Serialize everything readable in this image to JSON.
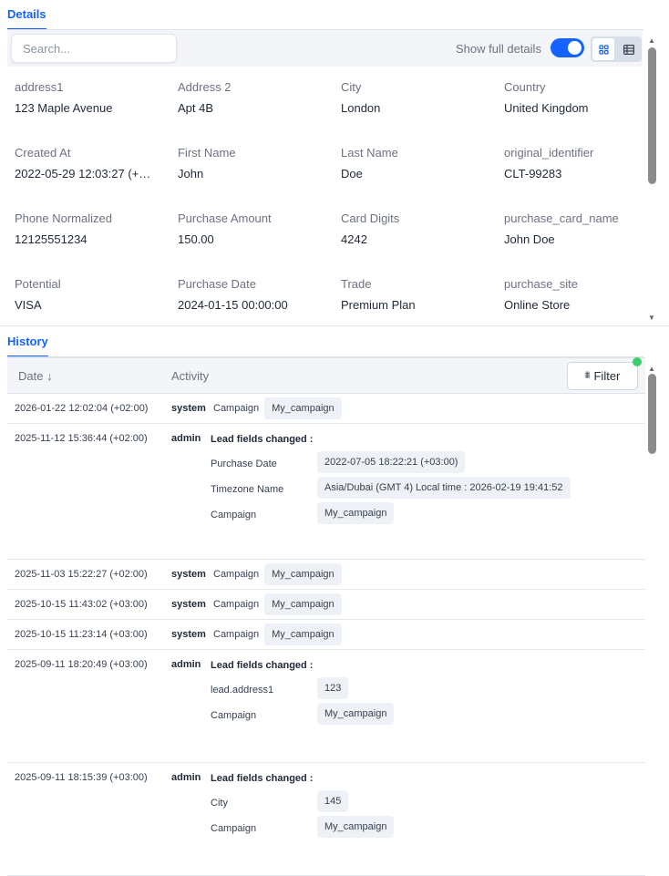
{
  "details": {
    "tab": "Details",
    "search_placeholder": "Search...",
    "show_full_label": "Show full details",
    "fields": [
      {
        "label": "address1",
        "value": "123 Maple Avenue"
      },
      {
        "label": "Address 2",
        "value": "Apt 4B"
      },
      {
        "label": "City",
        "value": "London"
      },
      {
        "label": "Country",
        "value": "United Kingdom"
      },
      {
        "label": "Created At",
        "value": "2022-05-29 12:03:27 (+…"
      },
      {
        "label": "First Name",
        "value": "John"
      },
      {
        "label": "Last Name",
        "value": "Doe"
      },
      {
        "label": "original_identifier",
        "value": "CLT-99283"
      },
      {
        "label": "Phone Normalized",
        "value": "12125551234"
      },
      {
        "label": "Purchase Amount",
        "value": "150.00"
      },
      {
        "label": "Card Digits",
        "value": "4242"
      },
      {
        "label": "purchase_card_name",
        "value": "John Doe"
      },
      {
        "label": "Potential",
        "value": "VISA"
      },
      {
        "label": "Purchase Date",
        "value": "2024-01-15 00:00:00"
      },
      {
        "label": "Trade",
        "value": "Premium Plan"
      },
      {
        "label": "purchase_site",
        "value": "Online Store"
      }
    ]
  },
  "history": {
    "tab": "History",
    "col_date": "Date ↓",
    "col_activity": "Activity",
    "filter_label": "Filter",
    "rows": [
      {
        "date": "2026-01-22 12:02:04 (+02:00)",
        "user": "system",
        "label": "Campaign",
        "value": "My_campaign"
      },
      {
        "date": "2025-11-12 15:36:44 (+02:00)",
        "user": "admin",
        "title": "Lead fields changed :",
        "changes": [
          {
            "field": "Purchase Date",
            "value": "2022-07-05 18:22:21 (+03:00)"
          },
          {
            "field": "Timezone Name",
            "value": "Asia/Dubai (GMT 4) Local time : 2026-02-19 19:41:52"
          },
          {
            "field": "Campaign",
            "value": "My_campaign"
          }
        ]
      },
      {
        "date": "2025-11-03 15:22:27 (+02:00)",
        "user": "system",
        "label": "Campaign",
        "value": "My_campaign"
      },
      {
        "date": "2025-10-15 11:43:02 (+03:00)",
        "user": "system",
        "label": "Campaign",
        "value": "My_campaign"
      },
      {
        "date": "2025-10-15 11:23:14 (+03:00)",
        "user": "system",
        "label": "Campaign",
        "value": "My_campaign"
      },
      {
        "date": "2025-09-11 18:20:49 (+03:00)",
        "user": "admin",
        "title": "Lead fields changed :",
        "changes": [
          {
            "field": "lead.address1",
            "value": "123"
          },
          {
            "field": "Campaign",
            "value": "My_campaign"
          }
        ]
      },
      {
        "date": "2025-09-11 18:15:39 (+03:00)",
        "user": "admin",
        "title": "Lead fields changed :",
        "changes": [
          {
            "field": "City",
            "value": "145"
          },
          {
            "field": "Campaign",
            "value": "My_campaign"
          }
        ]
      }
    ]
  }
}
